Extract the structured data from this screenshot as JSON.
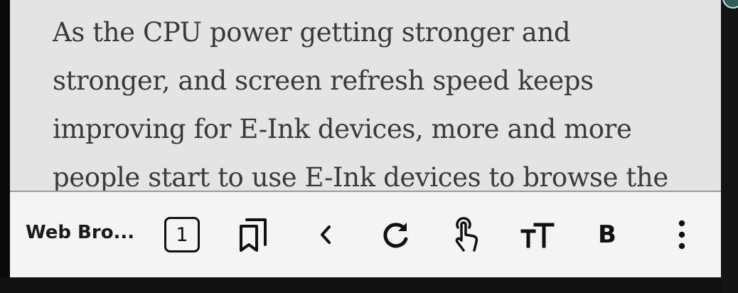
{
  "article": {
    "text": "As the CPU power getting stronger and\nstronger, and screen refresh speed keeps\nimproving for E-Ink devices, more and more\npeople start to use E-Ink devices to browse the"
  },
  "toolbar": {
    "title": "Web Bro...",
    "tab_count": "1",
    "bold_label": "B",
    "icons": {
      "tabs": "tab-count-icon",
      "bookmarks": "bookmarks-icon",
      "back": "chevron-left-icon",
      "reload": "reload-icon",
      "touch": "touch-pointer-icon",
      "font_size": "font-size-icon",
      "bold": "bold-icon",
      "menu": "more-vertical-icon"
    }
  },
  "colors": {
    "content_bg": "#e4e4e4",
    "toolbar_bg": "#f4f4f4",
    "text": "#3a3a3a",
    "icon": "#111111"
  }
}
